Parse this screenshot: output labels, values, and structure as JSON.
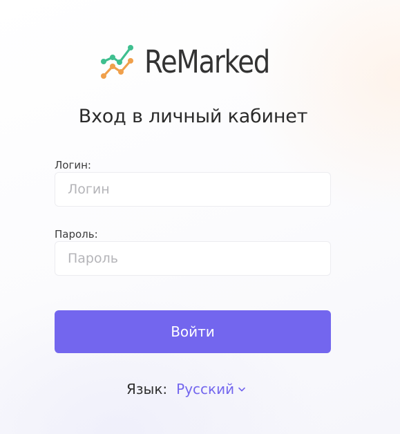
{
  "brand": {
    "name": "ReMarked",
    "logo_icon": "line-chart-logo-icon"
  },
  "title": "Вход в личный кабинет",
  "form": {
    "login_label": "Логин:",
    "login_placeholder": "Логин",
    "login_value": "",
    "password_label": "Пароль:",
    "password_placeholder": "Пароль",
    "password_value": "",
    "submit_label": "Войти"
  },
  "language": {
    "label": "Язык:",
    "selected": "Русский",
    "icon": "chevron-down-icon"
  },
  "colors": {
    "accent": "#7366ee",
    "logo_green": "#3fbf8f",
    "logo_orange": "#f0a04b",
    "text_dark": "#2a2a2a"
  }
}
